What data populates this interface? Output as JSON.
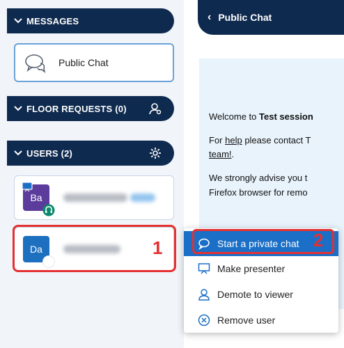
{
  "messages": {
    "label": "MESSAGES"
  },
  "public_chat_item": {
    "label": "Public Chat"
  },
  "floor_requests": {
    "label": "FLOOR REQUESTS (0)"
  },
  "users": {
    "label": "USERS (2)"
  },
  "user_list": [
    {
      "initials": "Ba",
      "color": "#5b3b9c"
    },
    {
      "initials": "Da",
      "color": "#1d6fbf"
    }
  ],
  "chat": {
    "header_title": "Public Chat",
    "welcome_prefix": "Welcome to ",
    "session_name": "Test session",
    "help_line_prefix": "For ",
    "help_link": "help",
    "help_line_suffix": " please contact T",
    "team_link": "team!",
    "team_suffix": ".",
    "advise_line1": "We strongly advise you t",
    "advise_line2": "Firefox browser for remo"
  },
  "context_menu": {
    "items": [
      {
        "label": "Start a private chat"
      },
      {
        "label": "Make presenter"
      },
      {
        "label": "Demote to viewer"
      },
      {
        "label": "Remove user"
      }
    ]
  },
  "annotations": {
    "step1": "1",
    "step2": "2"
  },
  "colors": {
    "navy": "#0f2a4f",
    "accent": "#1b6fc6",
    "highlight": "#e53030"
  }
}
